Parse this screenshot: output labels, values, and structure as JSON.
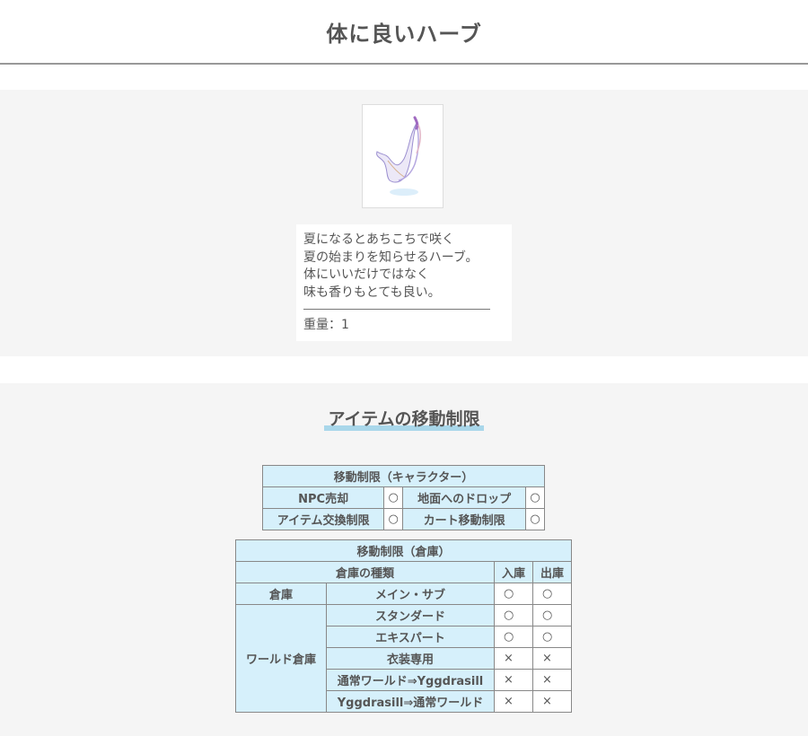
{
  "page_title": "体に良いハーブ",
  "description": {
    "lines": [
      "夏になるとあちこちで咲く",
      "夏の始まりを知らせるハーブ。",
      "体にいいだけではなく",
      "味も香りもとても良い。"
    ],
    "weight": "重量：1"
  },
  "section_title": "アイテムの移動制限",
  "character_table": {
    "title": "移動制限（キャラクター）",
    "rows": [
      {
        "label1": "NPC売却",
        "mark1": "○",
        "label2": "地面へのドロップ",
        "mark2": "○"
      },
      {
        "label1": "アイテム交換制限",
        "mark1": "○",
        "label2": "カート移動制限",
        "mark2": "○"
      }
    ]
  },
  "storage_table": {
    "title": "移動制限（倉庫）",
    "headers": {
      "type": "倉庫の種類",
      "in": "入庫",
      "out": "出庫"
    },
    "groups": {
      "storage": "倉庫",
      "world_storage": "ワールド倉庫"
    },
    "rows": [
      {
        "type": "メイン・サブ",
        "in": "○",
        "out": "○"
      },
      {
        "type": "スタンダード",
        "in": "○",
        "out": "○"
      },
      {
        "type": "エキスパート",
        "in": "○",
        "out": "○"
      },
      {
        "type": "衣装専用",
        "in": "×",
        "out": "×"
      },
      {
        "type": "通常ワールド⇒Yggdrasill",
        "in": "×",
        "out": "×"
      },
      {
        "type": "Yggdrasill⇒通常ワールド",
        "in": "×",
        "out": "×"
      }
    ]
  }
}
